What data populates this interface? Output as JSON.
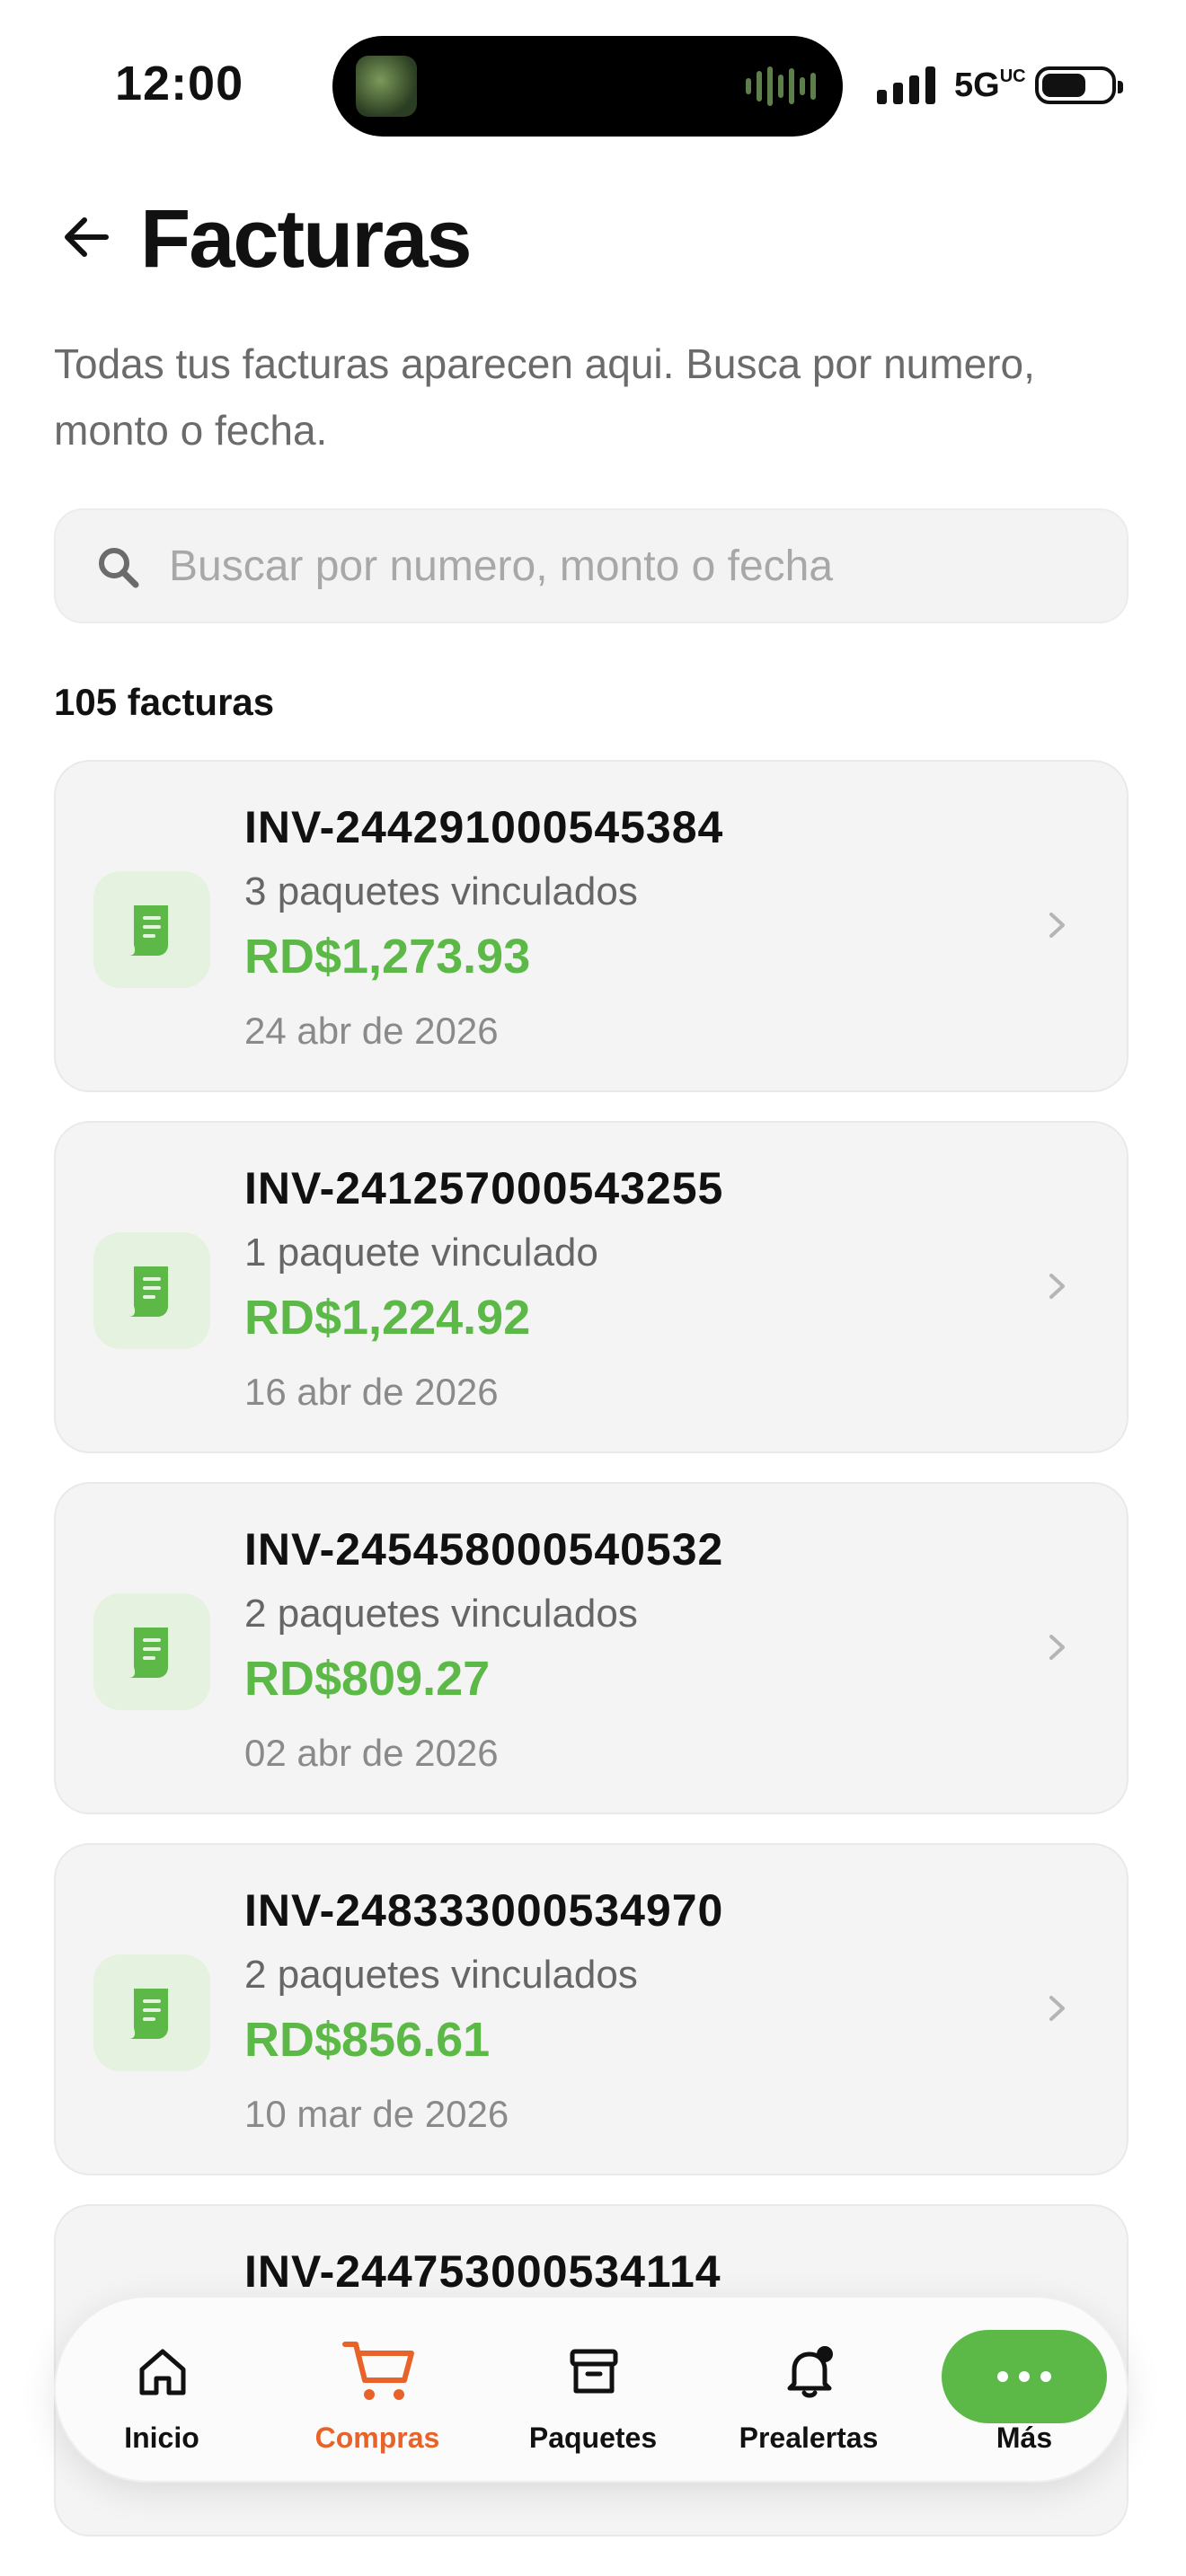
{
  "status_bar": {
    "time": "12:00",
    "network": "5G",
    "network_suffix": "UC"
  },
  "header": {
    "title": "Facturas",
    "subtitle": "Todas tus facturas aparecen aqui. Busca por numero, monto o fecha."
  },
  "search": {
    "placeholder": "Buscar por numero, monto o fecha",
    "value": ""
  },
  "summary": {
    "count_label": "105 facturas"
  },
  "invoices": [
    {
      "number": "INV-244291000545384",
      "packages": "3 paquetes vinculados",
      "amount": "RD$1,273.93",
      "date": "24 abr de 2026"
    },
    {
      "number": "INV-241257000543255",
      "packages": "1 paquete vinculado",
      "amount": "RD$1,224.92",
      "date": "16 abr de 2026"
    },
    {
      "number": "INV-245458000540532",
      "packages": "2 paquetes vinculados",
      "amount": "RD$809.27",
      "date": "02 abr de 2026"
    },
    {
      "number": "INV-248333000534970",
      "packages": "2 paquetes vinculados",
      "amount": "RD$856.61",
      "date": "10 mar de 2026"
    },
    {
      "number": "INV-244753000534114",
      "packages": "",
      "amount": "",
      "date": ""
    }
  ],
  "nav": {
    "items": [
      {
        "label": "Inicio",
        "icon": "home-icon",
        "active": false
      },
      {
        "label": "Compras",
        "icon": "cart-icon",
        "active": true
      },
      {
        "label": "Paquetes",
        "icon": "box-icon",
        "active": false
      },
      {
        "label": "Prealertas",
        "icon": "bell-icon",
        "active": false
      },
      {
        "label": "Más",
        "icon": "more-icon",
        "active": false
      }
    ]
  },
  "colors": {
    "accent_green": "#5cb947",
    "active_tab": "#e8632a",
    "icon_bg": "#e5f2df"
  }
}
